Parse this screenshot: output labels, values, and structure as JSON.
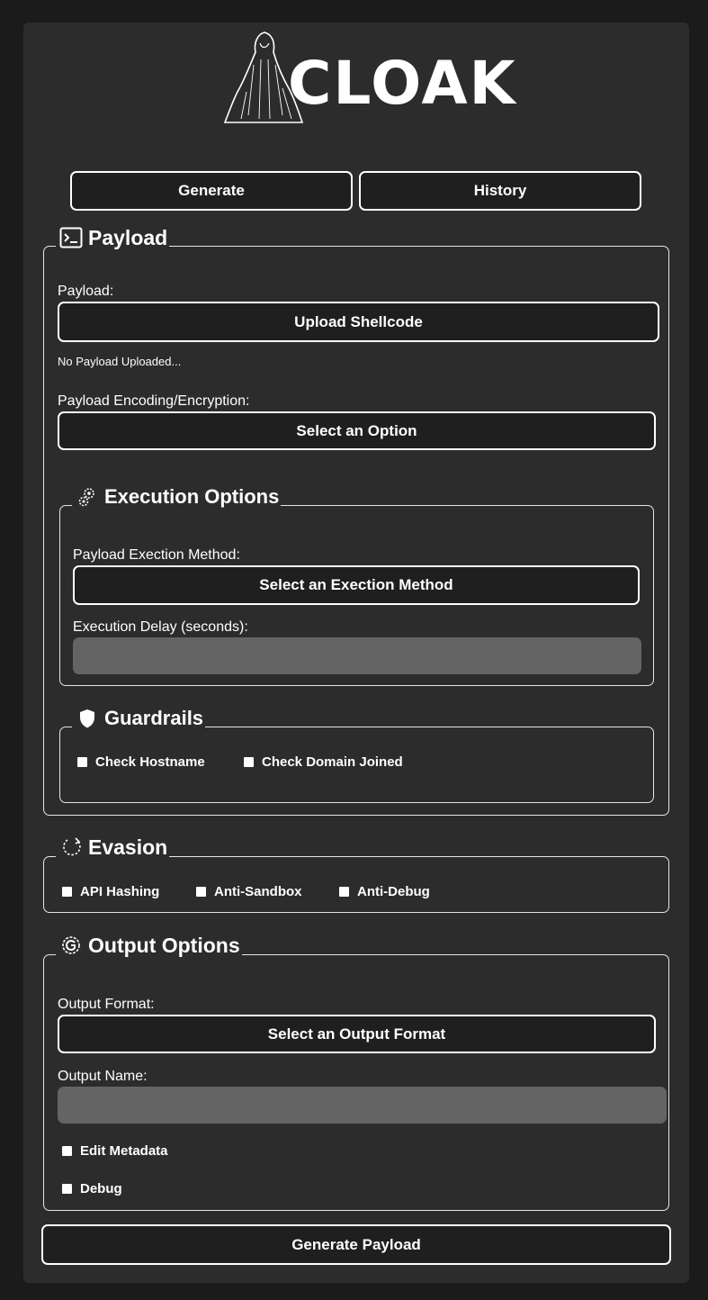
{
  "app": {
    "logo_text": "CLOAK"
  },
  "nav": {
    "generate_label": "Generate",
    "history_label": "History"
  },
  "payload_section": {
    "title": "Payload",
    "payload_label": "Payload:",
    "upload_button": "Upload Shellcode",
    "status_text": "No Payload Uploaded...",
    "encoding_label": "Payload Encoding/Encryption:",
    "encoding_select": "Select an Option"
  },
  "execution_section": {
    "title": "Execution Options",
    "method_label": "Payload Exection Method:",
    "method_select": "Select an Exection Method",
    "delay_label": "Execution Delay (seconds):",
    "delay_value": ""
  },
  "guardrails_section": {
    "title": "Guardrails",
    "options": [
      "Check Hostname",
      "Check Domain Joined"
    ]
  },
  "evasion_section": {
    "title": "Evasion",
    "options": [
      "API Hashing",
      "Anti-Sandbox",
      "Anti-Debug"
    ]
  },
  "output_section": {
    "title": "Output Options",
    "format_label": "Output Format:",
    "format_select": "Select an Output Format",
    "name_label": "Output Name:",
    "name_value": "",
    "edit_metadata": "Edit Metadata",
    "debug": "Debug"
  },
  "footer": {
    "generate_payload_button": "Generate Payload"
  }
}
